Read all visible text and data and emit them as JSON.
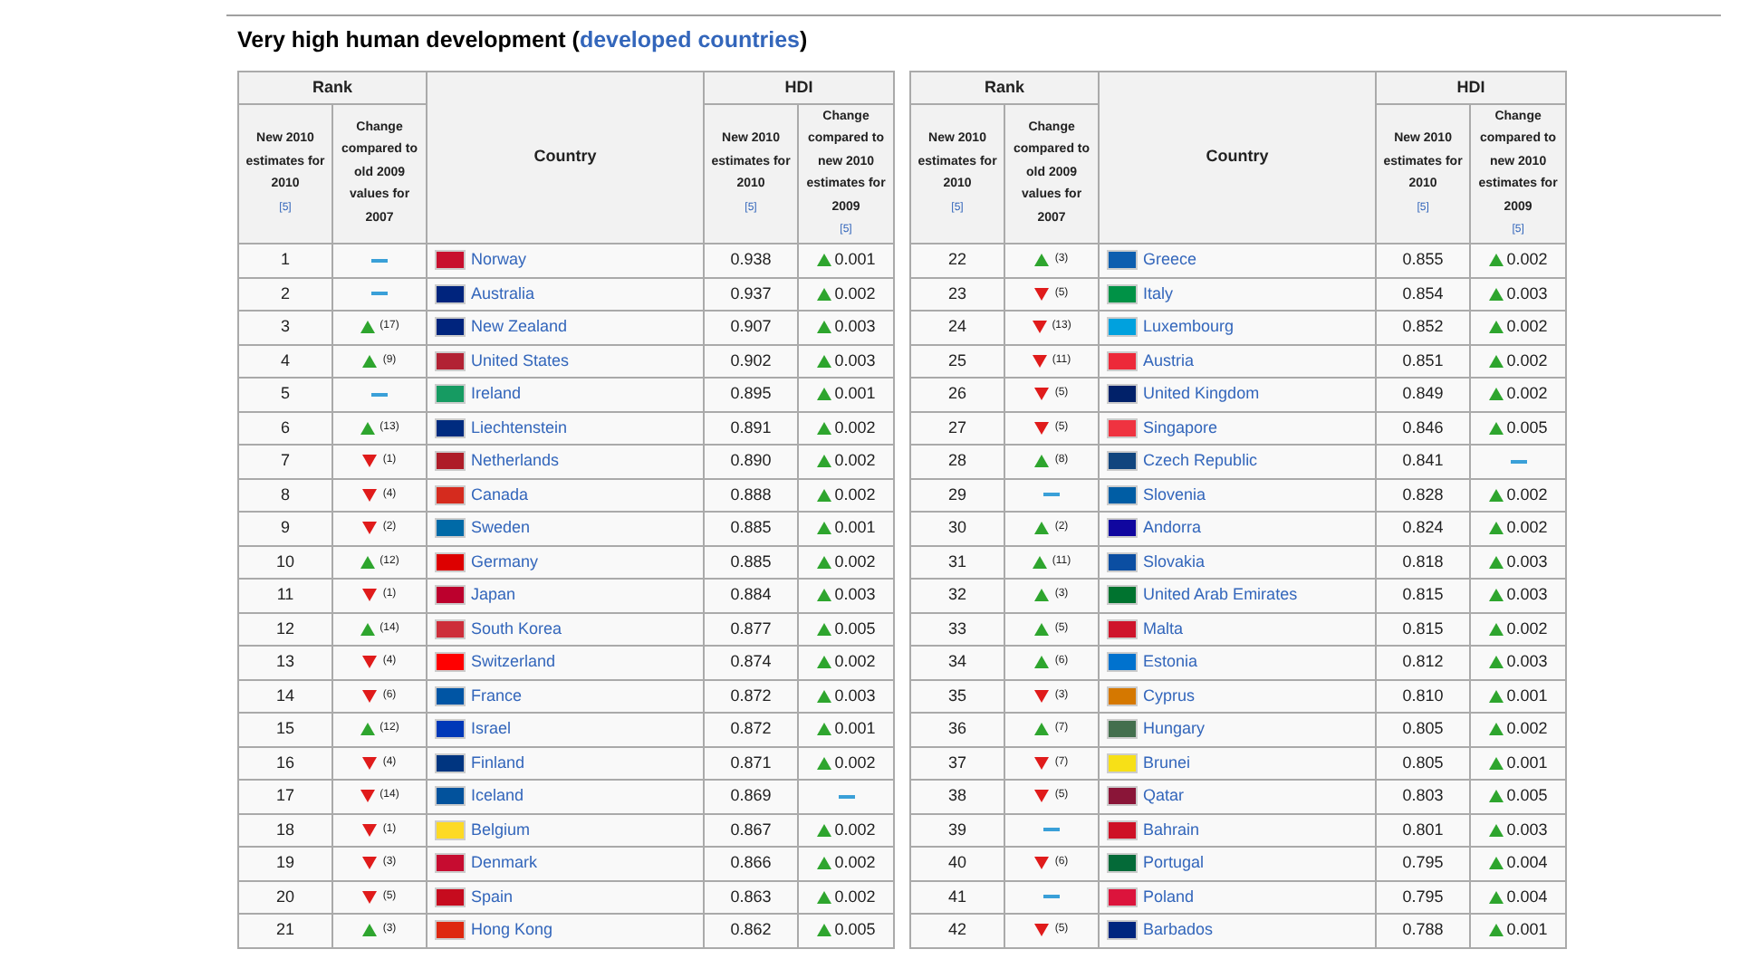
{
  "heading": {
    "prefix": "Very high human development (",
    "link": "developed countries",
    "suffix": ")"
  },
  "tables": [
    {
      "group_headers": [
        "Rank",
        "HDI"
      ],
      "country_header": "Country",
      "subheaders": [
        {
          "text": "New 2010 estimates for 2010",
          "note": "[5]"
        },
        {
          "text": "Change compared to old 2009 values for 2007"
        },
        {
          "text": "New 2010 estimates for 2010",
          "note": "[5]"
        },
        {
          "text": "Change compared to new 2010 estimates for 2009",
          "note": "[5]"
        }
      ],
      "rows": [
        {
          "rank": "1",
          "rank_change": {
            "kind": "same"
          },
          "country": "Norway",
          "color": "#c8102e",
          "hdi": "0.938",
          "hdi_change": {
            "kind": "up",
            "amount": "0.001"
          }
        },
        {
          "rank": "2",
          "rank_change": {
            "kind": "same"
          },
          "country": "Australia",
          "color": "#00247d",
          "hdi": "0.937",
          "hdi_change": {
            "kind": "up",
            "amount": "0.002"
          }
        },
        {
          "rank": "3",
          "rank_change": {
            "kind": "up",
            "amount": "(17)"
          },
          "country": "New Zealand",
          "color": "#00247d",
          "hdi": "0.907",
          "hdi_change": {
            "kind": "up",
            "amount": "0.003"
          }
        },
        {
          "rank": "4",
          "rank_change": {
            "kind": "up",
            "amount": "(9)"
          },
          "country": "United States",
          "color": "#b22234",
          "hdi": "0.902",
          "hdi_change": {
            "kind": "up",
            "amount": "0.003"
          }
        },
        {
          "rank": "5",
          "rank_change": {
            "kind": "same"
          },
          "country": "Ireland",
          "color": "#169b62",
          "hdi": "0.895",
          "hdi_change": {
            "kind": "up",
            "amount": "0.001"
          }
        },
        {
          "rank": "6",
          "rank_change": {
            "kind": "up",
            "amount": "(13)"
          },
          "country": "Liechtenstein",
          "color": "#002b7f",
          "hdi": "0.891",
          "hdi_change": {
            "kind": "up",
            "amount": "0.002"
          }
        },
        {
          "rank": "7",
          "rank_change": {
            "kind": "down",
            "amount": "(1)"
          },
          "country": "Netherlands",
          "color": "#ae1c28",
          "hdi": "0.890",
          "hdi_change": {
            "kind": "up",
            "amount": "0.002"
          }
        },
        {
          "rank": "8",
          "rank_change": {
            "kind": "down",
            "amount": "(4)"
          },
          "country": "Canada",
          "color": "#d52b1e",
          "hdi": "0.888",
          "hdi_change": {
            "kind": "up",
            "amount": "0.002"
          }
        },
        {
          "rank": "9",
          "rank_change": {
            "kind": "down",
            "amount": "(2)"
          },
          "country": "Sweden",
          "color": "#006aa7",
          "hdi": "0.885",
          "hdi_change": {
            "kind": "up",
            "amount": "0.001"
          }
        },
        {
          "rank": "10",
          "rank_change": {
            "kind": "up",
            "amount": "(12)"
          },
          "country": "Germany",
          "color": "#dd0000",
          "hdi": "0.885",
          "hdi_change": {
            "kind": "up",
            "amount": "0.002"
          }
        },
        {
          "rank": "11",
          "rank_change": {
            "kind": "down",
            "amount": "(1)"
          },
          "country": "Japan",
          "color": "#bc002d",
          "hdi": "0.884",
          "hdi_change": {
            "kind": "up",
            "amount": "0.003"
          }
        },
        {
          "rank": "12",
          "rank_change": {
            "kind": "up",
            "amount": "(14)"
          },
          "country": "South Korea",
          "color": "#cd2e3a",
          "hdi": "0.877",
          "hdi_change": {
            "kind": "up",
            "amount": "0.005"
          }
        },
        {
          "rank": "13",
          "rank_change": {
            "kind": "down",
            "amount": "(4)"
          },
          "country": "Switzerland",
          "color": "#ff0000",
          "hdi": "0.874",
          "hdi_change": {
            "kind": "up",
            "amount": "0.002"
          }
        },
        {
          "rank": "14",
          "rank_change": {
            "kind": "down",
            "amount": "(6)"
          },
          "country": "France",
          "color": "#0055a4",
          "hdi": "0.872",
          "hdi_change": {
            "kind": "up",
            "amount": "0.003"
          }
        },
        {
          "rank": "15",
          "rank_change": {
            "kind": "up",
            "amount": "(12)"
          },
          "country": "Israel",
          "color": "#0038b8",
          "hdi": "0.872",
          "hdi_change": {
            "kind": "up",
            "amount": "0.001"
          }
        },
        {
          "rank": "16",
          "rank_change": {
            "kind": "down",
            "amount": "(4)"
          },
          "country": "Finland",
          "color": "#003580",
          "hdi": "0.871",
          "hdi_change": {
            "kind": "up",
            "amount": "0.002"
          }
        },
        {
          "rank": "17",
          "rank_change": {
            "kind": "down",
            "amount": "(14)"
          },
          "country": "Iceland",
          "color": "#02529c",
          "hdi": "0.869",
          "hdi_change": {
            "kind": "same"
          }
        },
        {
          "rank": "18",
          "rank_change": {
            "kind": "down",
            "amount": "(1)"
          },
          "country": "Belgium",
          "color": "#fdda24",
          "hdi": "0.867",
          "hdi_change": {
            "kind": "up",
            "amount": "0.002"
          }
        },
        {
          "rank": "19",
          "rank_change": {
            "kind": "down",
            "amount": "(3)"
          },
          "country": "Denmark",
          "color": "#c60c30",
          "hdi": "0.866",
          "hdi_change": {
            "kind": "up",
            "amount": "0.002"
          }
        },
        {
          "rank": "20",
          "rank_change": {
            "kind": "down",
            "amount": "(5)"
          },
          "country": "Spain",
          "color": "#c60b1e",
          "hdi": "0.863",
          "hdi_change": {
            "kind": "up",
            "amount": "0.002"
          }
        },
        {
          "rank": "21",
          "rank_change": {
            "kind": "up",
            "amount": "(3)"
          },
          "country": "Hong Kong",
          "color": "#de2910",
          "hdi": "0.862",
          "hdi_change": {
            "kind": "up",
            "amount": "0.005"
          }
        }
      ]
    },
    {
      "group_headers": [
        "Rank",
        "HDI"
      ],
      "country_header": "Country",
      "subheaders": [
        {
          "text": "New 2010 estimates for 2010",
          "note": "[5]"
        },
        {
          "text": "Change compared to old 2009 values for 2007"
        },
        {
          "text": "New 2010 estimates for 2010",
          "note": "[5]"
        },
        {
          "text": "Change compared to new 2010 estimates for 2009",
          "note": "[5]"
        }
      ],
      "rows": [
        {
          "rank": "22",
          "rank_change": {
            "kind": "up",
            "amount": "(3)"
          },
          "country": "Greece",
          "color": "#0d5eaf",
          "hdi": "0.855",
          "hdi_change": {
            "kind": "up",
            "amount": "0.002"
          }
        },
        {
          "rank": "23",
          "rank_change": {
            "kind": "down",
            "amount": "(5)"
          },
          "country": "Italy",
          "color": "#009246",
          "hdi": "0.854",
          "hdi_change": {
            "kind": "up",
            "amount": "0.003"
          }
        },
        {
          "rank": "24",
          "rank_change": {
            "kind": "down",
            "amount": "(13)"
          },
          "country": "Luxembourg",
          "color": "#00a1de",
          "hdi": "0.852",
          "hdi_change": {
            "kind": "up",
            "amount": "0.002"
          }
        },
        {
          "rank": "25",
          "rank_change": {
            "kind": "down",
            "amount": "(11)"
          },
          "country": "Austria",
          "color": "#ed2939",
          "hdi": "0.851",
          "hdi_change": {
            "kind": "up",
            "amount": "0.002"
          }
        },
        {
          "rank": "26",
          "rank_change": {
            "kind": "down",
            "amount": "(5)"
          },
          "country": "United Kingdom",
          "color": "#012169",
          "hdi": "0.849",
          "hdi_change": {
            "kind": "up",
            "amount": "0.002"
          }
        },
        {
          "rank": "27",
          "rank_change": {
            "kind": "down",
            "amount": "(5)"
          },
          "country": "Singapore",
          "color": "#ef3340",
          "hdi": "0.846",
          "hdi_change": {
            "kind": "up",
            "amount": "0.005"
          }
        },
        {
          "rank": "28",
          "rank_change": {
            "kind": "up",
            "amount": "(8)"
          },
          "country": "Czech Republic",
          "color": "#11457e",
          "hdi": "0.841",
          "hdi_change": {
            "kind": "same"
          }
        },
        {
          "rank": "29",
          "rank_change": {
            "kind": "same"
          },
          "country": "Slovenia",
          "color": "#005da4",
          "hdi": "0.828",
          "hdi_change": {
            "kind": "up",
            "amount": "0.002"
          }
        },
        {
          "rank": "30",
          "rank_change": {
            "kind": "up",
            "amount": "(2)"
          },
          "country": "Andorra",
          "color": "#10069f",
          "hdi": "0.824",
          "hdi_change": {
            "kind": "up",
            "amount": "0.002"
          }
        },
        {
          "rank": "31",
          "rank_change": {
            "kind": "up",
            "amount": "(11)"
          },
          "country": "Slovakia",
          "color": "#0b4ea2",
          "hdi": "0.818",
          "hdi_change": {
            "kind": "up",
            "amount": "0.003"
          }
        },
        {
          "rank": "32",
          "rank_change": {
            "kind": "up",
            "amount": "(3)"
          },
          "country": "United Arab Emirates",
          "color": "#00732f",
          "hdi": "0.815",
          "hdi_change": {
            "kind": "up",
            "amount": "0.003"
          }
        },
        {
          "rank": "33",
          "rank_change": {
            "kind": "up",
            "amount": "(5)"
          },
          "country": "Malta",
          "color": "#cf142b",
          "hdi": "0.815",
          "hdi_change": {
            "kind": "up",
            "amount": "0.002"
          }
        },
        {
          "rank": "34",
          "rank_change": {
            "kind": "up",
            "amount": "(6)"
          },
          "country": "Estonia",
          "color": "#0072ce",
          "hdi": "0.812",
          "hdi_change": {
            "kind": "up",
            "amount": "0.003"
          }
        },
        {
          "rank": "35",
          "rank_change": {
            "kind": "down",
            "amount": "(3)"
          },
          "country": "Cyprus",
          "color": "#d57800",
          "hdi": "0.810",
          "hdi_change": {
            "kind": "up",
            "amount": "0.001"
          }
        },
        {
          "rank": "36",
          "rank_change": {
            "kind": "up",
            "amount": "(7)"
          },
          "country": "Hungary",
          "color": "#436f4d",
          "hdi": "0.805",
          "hdi_change": {
            "kind": "up",
            "amount": "0.002"
          }
        },
        {
          "rank": "37",
          "rank_change": {
            "kind": "down",
            "amount": "(7)"
          },
          "country": "Brunei",
          "color": "#f7e017",
          "hdi": "0.805",
          "hdi_change": {
            "kind": "up",
            "amount": "0.001"
          }
        },
        {
          "rank": "38",
          "rank_change": {
            "kind": "down",
            "amount": "(5)"
          },
          "country": "Qatar",
          "color": "#8a1538",
          "hdi": "0.803",
          "hdi_change": {
            "kind": "up",
            "amount": "0.005"
          }
        },
        {
          "rank": "39",
          "rank_change": {
            "kind": "same"
          },
          "country": "Bahrain",
          "color": "#ce1126",
          "hdi": "0.801",
          "hdi_change": {
            "kind": "up",
            "amount": "0.003"
          }
        },
        {
          "rank": "40",
          "rank_change": {
            "kind": "down",
            "amount": "(6)"
          },
          "country": "Portugal",
          "color": "#046a38",
          "hdi": "0.795",
          "hdi_change": {
            "kind": "up",
            "amount": "0.004"
          }
        },
        {
          "rank": "41",
          "rank_change": {
            "kind": "same"
          },
          "country": "Poland",
          "color": "#dc143c",
          "hdi": "0.795",
          "hdi_change": {
            "kind": "up",
            "amount": "0.004"
          }
        },
        {
          "rank": "42",
          "rank_change": {
            "kind": "down",
            "amount": "(5)"
          },
          "country": "Barbados",
          "color": "#00267f",
          "hdi": "0.788",
          "hdi_change": {
            "kind": "up",
            "amount": "0.001"
          }
        }
      ]
    }
  ]
}
